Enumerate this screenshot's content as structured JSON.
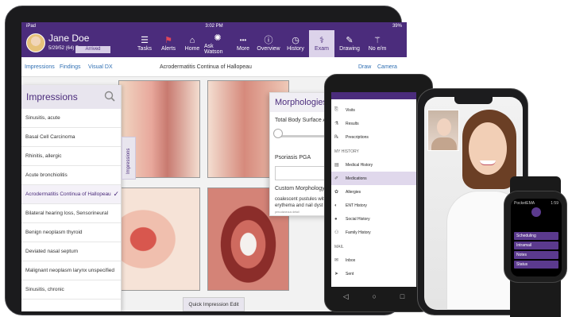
{
  "tablet": {
    "status": {
      "left": "iPad",
      "time": "3:02 PM",
      "right": "39%"
    },
    "patient": {
      "name": "Jane Doe",
      "dob": "5/29/52 (64) F",
      "status": "Arrived"
    },
    "toolbar": [
      {
        "label": "Tasks",
        "icon": "☰"
      },
      {
        "label": "Alerts",
        "icon": "⚑"
      },
      {
        "label": "Home",
        "icon": "⌂"
      },
      {
        "label": "Ask Watson",
        "icon": "✺"
      },
      {
        "label": "More",
        "icon": "•••"
      },
      {
        "label": "Overview",
        "icon": "ⓘ"
      },
      {
        "label": "History",
        "icon": "◷"
      },
      {
        "label": "Exam",
        "icon": "⚕"
      },
      {
        "label": "Drawing",
        "icon": "✎"
      },
      {
        "label": "No e/m",
        "icon": "⚚"
      }
    ],
    "subnav": {
      "impressions": "Impressions",
      "findings": "Findings",
      "visual_dx": "Visual DX",
      "title": "Acrodermatitis Continua of Hallopeau",
      "draw": "Draw",
      "camera": "Camera"
    },
    "impressions_panel": {
      "title": "Impressions",
      "tab_label": "Impressions",
      "items": [
        "Sinusitis, acute",
        "Basal Cell Carcinoma",
        "Rhinitis, allergic",
        "Acute bronchiolitis",
        "Acrodermatitis Continua of Hallopeau",
        "Bilateral hearing loss, Sensorineural",
        "Benign neoplasm thyroid",
        "Deviated nasal septum",
        "Malignant neoplasm larynx unspecified",
        "Sinusitis, chronic"
      ],
      "selected_index": 4,
      "quick_edit": "Quick Impression Edit"
    },
    "morphologies": {
      "title": "Morphologies",
      "field1": "Total Body Surface Area",
      "field2": "Psoriasis PGA",
      "field3": "Custom Morphology",
      "custom_text": "coalescent pustules with erythema and nail dyst",
      "fine_print": "percutaneous detail"
    }
  },
  "android": {
    "items_top": [
      {
        "label": "Visits",
        "icon": "⎘"
      },
      {
        "label": "Results",
        "icon": "⚗"
      },
      {
        "label": "Prescriptions",
        "icon": "℞"
      }
    ],
    "section_history": "MY HISTORY",
    "items_history": [
      {
        "label": "Medical History",
        "icon": "▤"
      },
      {
        "label": "Medications",
        "icon": "✐"
      },
      {
        "label": "Allergies",
        "icon": "✿"
      },
      {
        "label": "ENT History",
        "icon": "◐"
      },
      {
        "label": "Social History",
        "icon": "●"
      },
      {
        "label": "Family History",
        "icon": "⚇"
      }
    ],
    "selected": "Medications",
    "section_mail": "MAIL",
    "items_mail": [
      {
        "label": "Inbox",
        "icon": "✉"
      },
      {
        "label": "Sent",
        "icon": "➤"
      }
    ]
  },
  "watch": {
    "title": "PocketEMA",
    "time": "1:59",
    "buttons": [
      "Scheduling",
      "Intramail",
      "Notes",
      "Status"
    ]
  },
  "colors": {
    "brand": "#4b2c7c",
    "accent_light": "#dcd3ea"
  }
}
